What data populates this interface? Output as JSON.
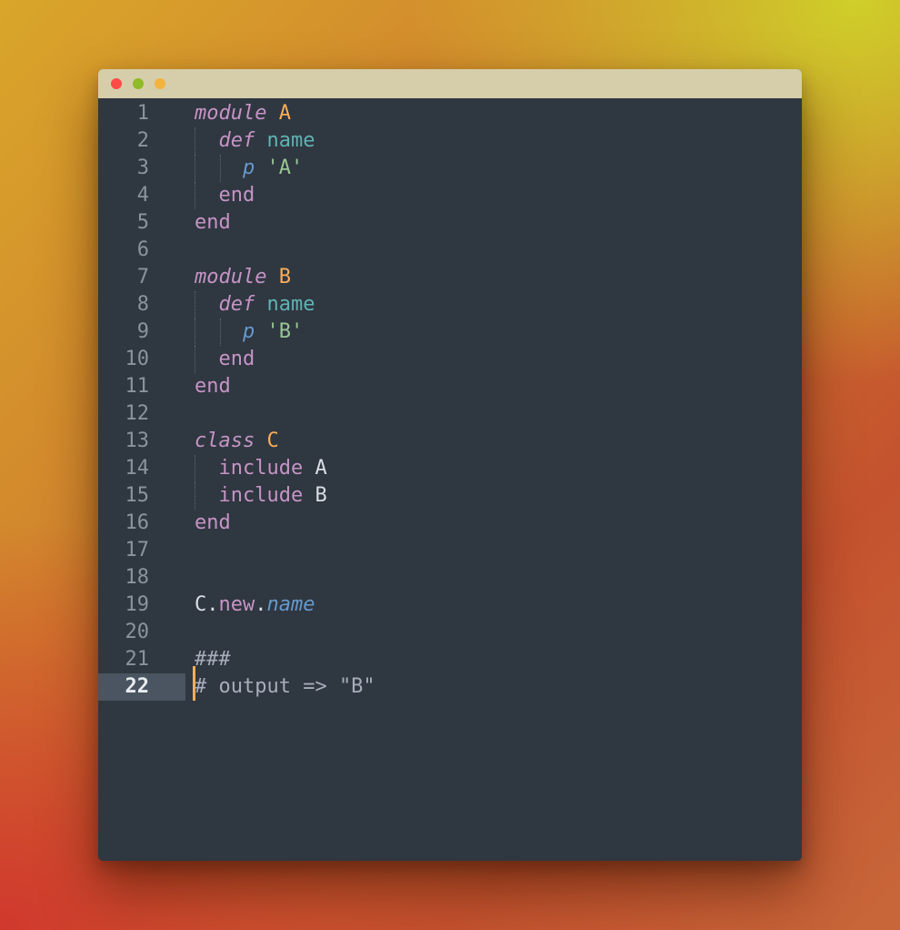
{
  "window": {
    "controls": [
      "close",
      "minimize",
      "maximize"
    ]
  },
  "colors": {
    "keyword": "#c594c5",
    "constant": "#f9ae58",
    "method": "#5fb3b3",
    "function": "#6699cc",
    "string": "#99c794",
    "comment": "#a7adba",
    "background": "#2f3740",
    "titlebar": "#d6ceaa"
  },
  "editor": {
    "active_line": 22,
    "lines": [
      {
        "num": "1",
        "t": [
          "module",
          "A"
        ]
      },
      {
        "num": "2",
        "t": [
          "def",
          "name"
        ]
      },
      {
        "num": "3",
        "t": [
          "p",
          "'A'"
        ]
      },
      {
        "num": "4",
        "t": [
          "end"
        ]
      },
      {
        "num": "5",
        "t": [
          "end"
        ]
      },
      {
        "num": "6",
        "t": []
      },
      {
        "num": "7",
        "t": [
          "module",
          "B"
        ]
      },
      {
        "num": "8",
        "t": [
          "def",
          "name"
        ]
      },
      {
        "num": "9",
        "t": [
          "p",
          "'B'"
        ]
      },
      {
        "num": "10",
        "t": [
          "end"
        ]
      },
      {
        "num": "11",
        "t": [
          "end"
        ]
      },
      {
        "num": "12",
        "t": []
      },
      {
        "num": "13",
        "t": [
          "class",
          "C"
        ]
      },
      {
        "num": "14",
        "t": [
          "include",
          "A"
        ]
      },
      {
        "num": "15",
        "t": [
          "include",
          "B"
        ]
      },
      {
        "num": "16",
        "t": [
          "end"
        ]
      },
      {
        "num": "17",
        "t": []
      },
      {
        "num": "18",
        "t": []
      },
      {
        "num": "19",
        "t": [
          "C",
          ".",
          "new",
          ".",
          "name"
        ]
      },
      {
        "num": "20",
        "t": []
      },
      {
        "num": "21",
        "t": [
          "###"
        ]
      },
      {
        "num": "22",
        "t": [
          "# output => \"B\""
        ]
      }
    ]
  }
}
